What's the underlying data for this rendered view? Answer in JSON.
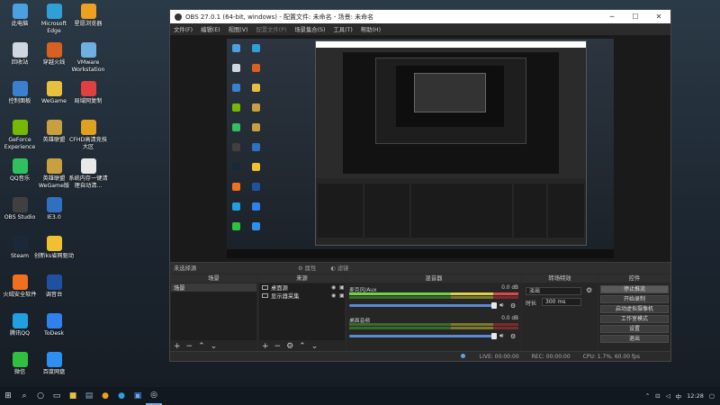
{
  "desktop_icons": [
    {
      "label": "此电脑",
      "color": "#4aa0e0"
    },
    {
      "label": "Microsoft Edge",
      "color": "#2f9fd8"
    },
    {
      "label": "星愿浏览器",
      "color": "#f0a020"
    },
    {
      "label": "回收站",
      "color": "#cfd8e0"
    },
    {
      "label": "穿越火线",
      "color": "#d86020"
    },
    {
      "label": "VMware Workstation",
      "color": "#6fb0e0"
    },
    {
      "label": "控制面板",
      "color": "#3a80d0"
    },
    {
      "label": "WeGame",
      "color": "#e8c040"
    },
    {
      "label": "局域网复制",
      "color": "#e04040"
    },
    {
      "label": "GeForce Experience",
      "color": "#76b900"
    },
    {
      "label": "英雄联盟",
      "color": "#c8a040"
    },
    {
      "label": "CFHD高清竞技大区",
      "color": "#e0a020"
    },
    {
      "label": "QQ音乐",
      "color": "#30c060"
    },
    {
      "label": "英雄联盟WeGame版",
      "color": "#c8a040"
    },
    {
      "label": "系统内存一键清理自动清...",
      "color": "#e8e8e8"
    },
    {
      "label": "OBS Studio",
      "color": "#404040"
    },
    {
      "label": "IE3.0",
      "color": "#3070c0"
    },
    {
      "label": "Steam",
      "color": "#1b2838"
    },
    {
      "label": "创新ks省网驱动",
      "color": "#f0c030"
    },
    {
      "label": "火绒安全软件",
      "color": "#f07020"
    },
    {
      "label": "调音台",
      "color": "#2050a0"
    },
    {
      "label": "腾讯QQ",
      "color": "#20a0e0"
    },
    {
      "label": "ToDesk",
      "color": "#3080f0"
    },
    {
      "label": "微信",
      "color": "#30c040"
    },
    {
      "label": "百度网盘",
      "color": "#2f8ff0"
    }
  ],
  "window": {
    "title": "OBS 27.0.1 (64-bit, windows) - 配置文件: 未命名 - 场景: 未命名",
    "min": "─",
    "max": "☐",
    "close": "✕"
  },
  "menu": [
    {
      "label": "文件(F)"
    },
    {
      "label": "编辑(E)"
    },
    {
      "label": "视图(V)"
    },
    {
      "label": "配置文件(P)"
    },
    {
      "label": "场景集合(S)"
    },
    {
      "label": "工具(T)"
    },
    {
      "label": "帮助(H)"
    }
  ],
  "dockbar": {
    "no_source": "未选择源",
    "properties": "属性",
    "filters": "滤镜"
  },
  "scenes": {
    "title": "场景",
    "items": [
      "场景"
    ]
  },
  "sources": {
    "title": "来源",
    "items": [
      "桌面源",
      "显示器采集"
    ]
  },
  "mixer": {
    "title": "混音器",
    "channels": [
      {
        "name": "麦克风/Aux",
        "db": "0.0 dB"
      },
      {
        "name": "桌面音频",
        "db": "0.0 dB"
      }
    ]
  },
  "transitions": {
    "title": "转场特效",
    "type": "淡出",
    "duration_label": "时长",
    "duration": "300 ms"
  },
  "controls": {
    "title": "控件",
    "buttons": [
      "停止推流",
      "开始录制",
      "启动虚拟摄像机",
      "工作室模式",
      "设置",
      "退出"
    ]
  },
  "status": {
    "live": "LIVE: 00:00:00",
    "rec": "REC: 00:00:00",
    "cpu": "CPU: 1.7%, 60.00 fps"
  },
  "tray": {
    "ime": "中",
    "time": "12:28"
  }
}
